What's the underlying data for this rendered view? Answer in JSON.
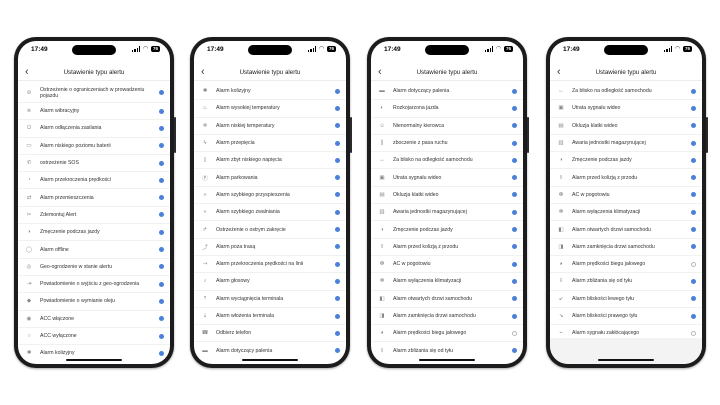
{
  "time": "17:49",
  "battery": "76",
  "title": "Ustawienie typu alertu",
  "colors": {
    "checked": "#4a80d9",
    "frame": "#1c1c1e"
  },
  "screens": [
    {
      "items": [
        {
          "label": "Ostrzeżenie o ograniczeniach w prowadzeniu pojazdu",
          "icon": "limit-icon",
          "checked": true
        },
        {
          "label": "Alarm wibracyjny",
          "icon": "vibration-icon",
          "checked": true
        },
        {
          "label": "Alarm odłączenia zasilania",
          "icon": "power-icon",
          "checked": true
        },
        {
          "label": "Alarm niskiego poziomu baterii",
          "icon": "battery-icon",
          "checked": true
        },
        {
          "label": "ostrzeżenie SOS",
          "icon": "sos-icon",
          "checked": true
        },
        {
          "label": "Alarm przekroczenia prędkości",
          "icon": "speedometer-icon",
          "checked": true
        },
        {
          "label": "Alarm przemieszczenia",
          "icon": "move-icon",
          "checked": true
        },
        {
          "label": "Zdemontuj Alert",
          "icon": "tool-icon",
          "checked": true
        },
        {
          "label": "Zmęczenie podczas jazdy",
          "icon": "fatigue-icon",
          "checked": true
        },
        {
          "label": "Alarm offline",
          "icon": "offline-icon",
          "checked": true
        },
        {
          "label": "Geo-ogrodzenie w stanie alertu",
          "icon": "geofence-icon",
          "checked": true
        },
        {
          "label": "Powiadomienie o wyjściu z geo-ogrodzenia",
          "icon": "exit-icon",
          "checked": true
        },
        {
          "label": "Powiadomienie o wymianie oleju",
          "icon": "oil-icon",
          "checked": true
        },
        {
          "label": "ACC włączone",
          "icon": "acc-on-icon",
          "checked": true
        },
        {
          "label": "ACC wyłączone",
          "icon": "acc-off-icon",
          "checked": true
        },
        {
          "label": "Alarm kolizyjny",
          "icon": "collision-icon",
          "checked": true
        }
      ]
    },
    {
      "items": [
        {
          "label": "Alarm kolizyjny",
          "icon": "collision-icon",
          "checked": true
        },
        {
          "label": "Alarm wysokiej temperatury",
          "icon": "temp-high-icon",
          "checked": true
        },
        {
          "label": "Alarm niskiej temperatury",
          "icon": "temp-low-icon",
          "checked": true
        },
        {
          "label": "Alarm przepięcia",
          "icon": "surge-icon",
          "checked": true
        },
        {
          "label": "Alarm zbyt niskiego napięcia",
          "icon": "voltage-icon",
          "checked": true
        },
        {
          "label": "Alarm parkowania",
          "icon": "parking-icon",
          "checked": true
        },
        {
          "label": "Alarm szybkiego przyspieszenia",
          "icon": "accel-icon",
          "checked": true
        },
        {
          "label": "Alarm szybkiego zwalniania",
          "icon": "decel-icon",
          "checked": true
        },
        {
          "label": "Ostrzeżenie o ostrym zakręcie",
          "icon": "turn-icon",
          "checked": true
        },
        {
          "label": "Alarm poza trasą",
          "icon": "route-icon",
          "checked": true
        },
        {
          "label": "Alarm przekroczenia prędkości na linii",
          "icon": "line-speed-icon",
          "checked": true
        },
        {
          "label": "Alarm głosowy",
          "icon": "voice-icon",
          "checked": true
        },
        {
          "label": "Alarm wyciągnięcia terminala",
          "icon": "terminal-out-icon",
          "checked": true
        },
        {
          "label": "Alarm włożenia terminala",
          "icon": "terminal-in-icon",
          "checked": true
        },
        {
          "label": "Odbierz telefon",
          "icon": "phone-icon",
          "checked": true
        },
        {
          "label": "Alarm dotyczący palenia",
          "icon": "smoking-icon",
          "checked": true
        }
      ]
    },
    {
      "items": [
        {
          "label": "Alarm dotyczący palenia",
          "icon": "smoking-icon",
          "checked": true
        },
        {
          "label": "Rozkojarzona jazda",
          "icon": "distracted-icon",
          "checked": true
        },
        {
          "label": "Nienormalny kierowca",
          "icon": "driver-icon",
          "checked": true
        },
        {
          "label": "zboczenie z pasa ruchu",
          "icon": "lane-icon",
          "checked": true
        },
        {
          "label": "Za blisko na odległość samochodu",
          "icon": "distance-icon",
          "checked": true
        },
        {
          "label": "Utrata sygnału wideo",
          "icon": "video-loss-icon",
          "checked": true
        },
        {
          "label": "Okluzja klatki wideo",
          "icon": "video-block-icon",
          "checked": true
        },
        {
          "label": "Awaria jednostki magazynującej",
          "icon": "storage-icon",
          "checked": true
        },
        {
          "label": "Zmęczenie podczas jazdy",
          "icon": "fatigue-icon",
          "checked": true
        },
        {
          "label": "Alarm przed kolizją z przodu",
          "icon": "front-collision-icon",
          "checked": true
        },
        {
          "label": "AC w pogotowiu",
          "icon": "ac-icon",
          "checked": true
        },
        {
          "label": "Alarm wyłączenia klimatyzacji",
          "icon": "ac-off-icon",
          "checked": true
        },
        {
          "label": "Alarm otwartych drzwi samochodu",
          "icon": "door-open-icon",
          "checked": true
        },
        {
          "label": "Alarm zamknięcia drzwi samochodu",
          "icon": "door-close-icon",
          "checked": true
        },
        {
          "label": "Alarm prędkości biegu jałowego",
          "icon": "idle-icon",
          "checked": false
        },
        {
          "label": "Alarm zbliżania się od tyłu",
          "icon": "rear-icon",
          "checked": true
        }
      ]
    },
    {
      "items": [
        {
          "label": "Za blisko na odległość samochodu",
          "icon": "distance-icon",
          "checked": true
        },
        {
          "label": "Utrata sygnału wideo",
          "icon": "video-loss-icon",
          "checked": true
        },
        {
          "label": "Okluzja klatki wideo",
          "icon": "video-block-icon",
          "checked": true
        },
        {
          "label": "Awaria jednostki magazynującej",
          "icon": "storage-icon",
          "checked": true
        },
        {
          "label": "Zmęczenie podczas jazdy",
          "icon": "fatigue-icon",
          "checked": true
        },
        {
          "label": "Alarm przed kolizją z przodu",
          "icon": "front-collision-icon",
          "checked": true
        },
        {
          "label": "AC w pogotowiu",
          "icon": "ac-icon",
          "checked": true
        },
        {
          "label": "Alarm wyłączenia klimatyzacji",
          "icon": "ac-off-icon",
          "checked": true
        },
        {
          "label": "Alarm otwartych drzwi samochodu",
          "icon": "door-open-icon",
          "checked": true
        },
        {
          "label": "Alarm zamknięcia drzwi samochodu",
          "icon": "door-close-icon",
          "checked": true
        },
        {
          "label": "Alarm prędkości biegu jałowego",
          "icon": "idle-icon",
          "checked": false
        },
        {
          "label": "Alarm zbliżania się od tyłu",
          "icon": "rear-icon",
          "checked": true
        },
        {
          "label": "Alarm bliskości lewego tyłu",
          "icon": "rear-left-icon",
          "checked": true
        },
        {
          "label": "Alarm bliskości prawego tyłu",
          "icon": "rear-right-icon",
          "checked": true
        },
        {
          "label": "Alarm sygnału zakłócającego",
          "icon": "jamming-icon",
          "checked": false
        }
      ]
    }
  ]
}
